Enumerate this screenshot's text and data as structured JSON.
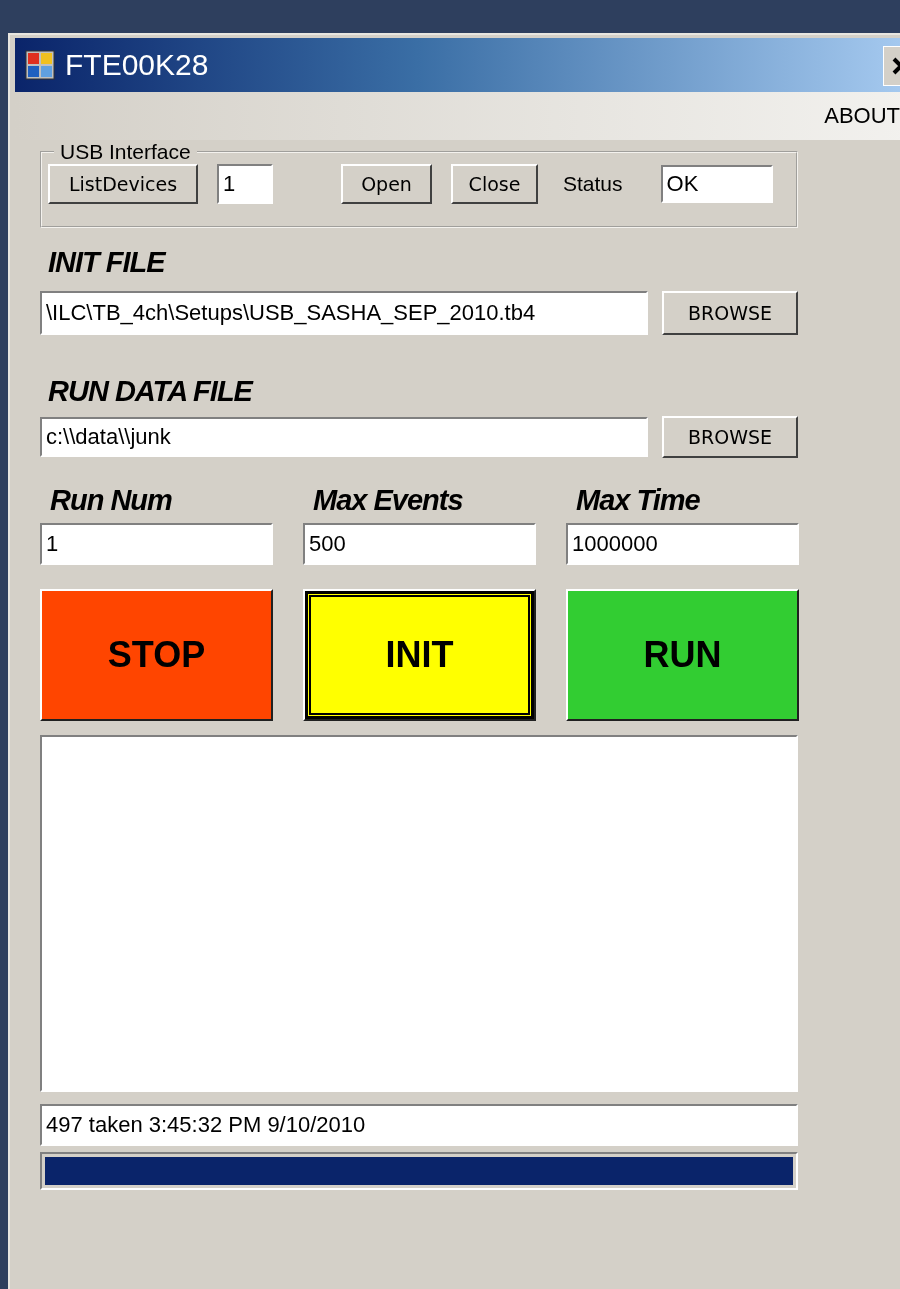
{
  "window": {
    "title": "FTE00K28"
  },
  "menu": [
    {
      "label": "ABOUT"
    }
  ],
  "usb_interface": {
    "title": "USB Interface",
    "list_devices_button": "ListDevices",
    "device_field": {
      "value": "1"
    },
    "open_button": "Open",
    "close_button": "Close",
    "status_label": "Status",
    "status_field": {
      "value": "OK"
    }
  },
  "init_file": {
    "label": "INIT FILE",
    "path_field": {
      "value": "\\ILC\\TB_4ch\\Setups\\USB_SASHA_SEP_2010.tb4"
    },
    "browse_button": "BROWSE"
  },
  "run_data_file": {
    "label": "RUN DATA FILE",
    "path_field": {
      "value": "c:\\\\data\\\\junk"
    },
    "browse_button": "BROWSE"
  },
  "parameters": [
    {
      "label": "Run Num",
      "value": "1"
    },
    {
      "label": "Max Events",
      "value": "500"
    },
    {
      "label": "Max Time",
      "value": "1000000"
    }
  ],
  "action_buttons": [
    {
      "label": "STOP",
      "color": "#ff4500",
      "focused": false
    },
    {
      "label": "INIT",
      "color": "#ffff00",
      "focused": true
    },
    {
      "label": "RUN",
      "color": "#32cd32",
      "focused": false
    }
  ],
  "status_line": {
    "value": "497 taken 3:45:32 PM 9/10/2010"
  },
  "progress": {
    "level": 1
  }
}
